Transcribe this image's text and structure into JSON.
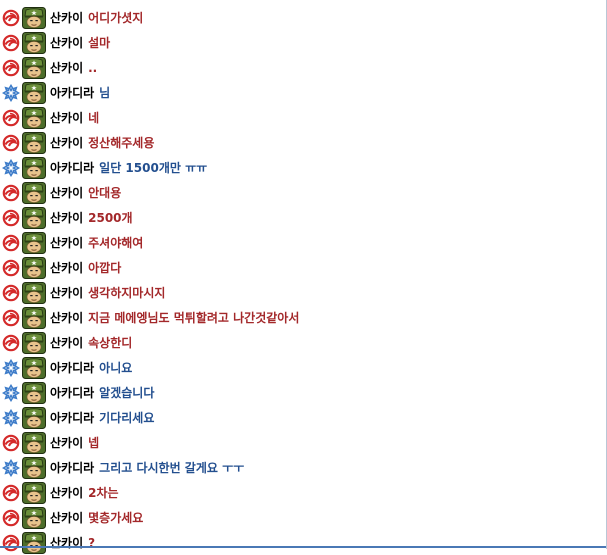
{
  "colors": {
    "sankai_text": "#a3282a",
    "arcadia_text": "#234f8f",
    "name_text": "#000000"
  },
  "messages": [
    {
      "speaker": "산카이",
      "text": "어디가셧지",
      "faction": "red-swirl-icon"
    },
    {
      "speaker": "산카이",
      "text": "설마",
      "faction": "red-swirl-icon"
    },
    {
      "speaker": "산카이",
      "text": "..",
      "faction": "red-swirl-icon"
    },
    {
      "speaker": "아카디라",
      "text": "님",
      "faction": "blue-snowflake-icon"
    },
    {
      "speaker": "산카이",
      "text": "네",
      "faction": "red-swirl-icon"
    },
    {
      "speaker": "산카이",
      "text": "정산해주세용",
      "faction": "red-swirl-icon"
    },
    {
      "speaker": "아카디라",
      "text": "일단 1500개만 ㅠㅠ",
      "faction": "blue-snowflake-icon"
    },
    {
      "speaker": "산카이",
      "text": "안대용",
      "faction": "red-swirl-icon"
    },
    {
      "speaker": "산카이",
      "text": "2500개",
      "faction": "red-swirl-icon"
    },
    {
      "speaker": "산카이",
      "text": "주셔야해여",
      "faction": "red-swirl-icon"
    },
    {
      "speaker": "산카이",
      "text": "아깝다",
      "faction": "red-swirl-icon"
    },
    {
      "speaker": "산카이",
      "text": "생각하지마시지",
      "faction": "red-swirl-icon"
    },
    {
      "speaker": "산카이",
      "text": "지금 메에엥님도 먹튀할려고 나간것같아서",
      "faction": "red-swirl-icon"
    },
    {
      "speaker": "산카이",
      "text": "속상한디",
      "faction": "red-swirl-icon"
    },
    {
      "speaker": "아카디라",
      "text": "아니요",
      "faction": "blue-snowflake-icon"
    },
    {
      "speaker": "아카디라",
      "text": "알겠습니다",
      "faction": "blue-snowflake-icon"
    },
    {
      "speaker": "아카디라",
      "text": "기다리세요",
      "faction": "blue-snowflake-icon"
    },
    {
      "speaker": "산카이",
      "text": "넵",
      "faction": "red-swirl-icon"
    },
    {
      "speaker": "아카디라",
      "text": "그리고 다시한번 갈게요 ㅜㅜ",
      "faction": "blue-snowflake-icon"
    },
    {
      "speaker": "산카이",
      "text": "2차는",
      "faction": "red-swirl-icon"
    },
    {
      "speaker": "산카이",
      "text": "몇층가세요",
      "faction": "red-swirl-icon"
    },
    {
      "speaker": "산카이",
      "text": "?",
      "faction": "red-swirl-icon"
    }
  ]
}
